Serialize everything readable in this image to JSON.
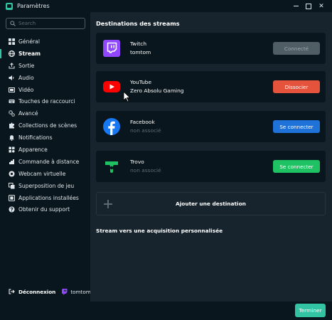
{
  "window": {
    "title": "Paramètres",
    "minimize_icon": "minimize-icon",
    "maximize_icon": "maximize-icon",
    "close_icon": "close-icon",
    "close_glyph": "✕"
  },
  "sidebar": {
    "search_placeholder": "Search",
    "items": [
      {
        "label": "Général",
        "icon": "grid-icon"
      },
      {
        "label": "Stream",
        "icon": "globe-icon",
        "active": true
      },
      {
        "label": "Sortie",
        "icon": "output-icon"
      },
      {
        "label": "Audio",
        "icon": "speaker-icon"
      },
      {
        "label": "Vidéo",
        "icon": "video-icon"
      },
      {
        "label": "Touches de raccourci",
        "icon": "keyboard-icon"
      },
      {
        "label": "Avancé",
        "icon": "gears-icon"
      },
      {
        "label": "Collections de scènes",
        "icon": "puzzle-icon"
      },
      {
        "label": "Notifications",
        "icon": "bell-icon"
      },
      {
        "label": "Apparence",
        "icon": "palette-icon"
      },
      {
        "label": "Commande à distance",
        "icon": "remote-icon"
      },
      {
        "label": "Webcam virtuelle",
        "icon": "camera-icon"
      },
      {
        "label": "Superposition de jeu",
        "icon": "overlay-icon"
      },
      {
        "label": "Applications installées",
        "icon": "apps-icon"
      },
      {
        "label": "Obtenir du support",
        "icon": "help-icon"
      }
    ],
    "footer": {
      "logout_label": "Déconnexion",
      "username": "tomtom"
    }
  },
  "main": {
    "section_title": "Destinations des streams",
    "destinations": [
      {
        "platform": "Twitch",
        "account": "tomtom",
        "button": "Connecté",
        "state": "connected",
        "icon": "twitch-icon",
        "color": "#9146ff"
      },
      {
        "platform": "YouTube",
        "account": "Zero Absolu Gaming",
        "button": "Dissocier",
        "state": "linked",
        "icon": "youtube-icon",
        "color": "#ff0000"
      },
      {
        "platform": "Facebook",
        "account": "non associé",
        "button": "Se connecter",
        "state": "unlinked",
        "icon": "facebook-icon",
        "color": "#1877f2"
      },
      {
        "platform": "Trovo",
        "account": "non associé",
        "button": "Se connecter",
        "state": "unlinked",
        "icon": "trovo-icon",
        "color": "#1fc262"
      }
    ],
    "add_destination_label": "Ajouter une destination",
    "custom_ingest_label": "Stream vers une acquisition personnalisée"
  },
  "footer": {
    "done_label": "Terminer"
  },
  "colors": {
    "accent": "#31c3a2",
    "background": "#09161d",
    "panel": "#17242d",
    "disconnect": "#e6533c",
    "facebook_button": "#1f72d7",
    "trovo_button": "#1fc262"
  }
}
